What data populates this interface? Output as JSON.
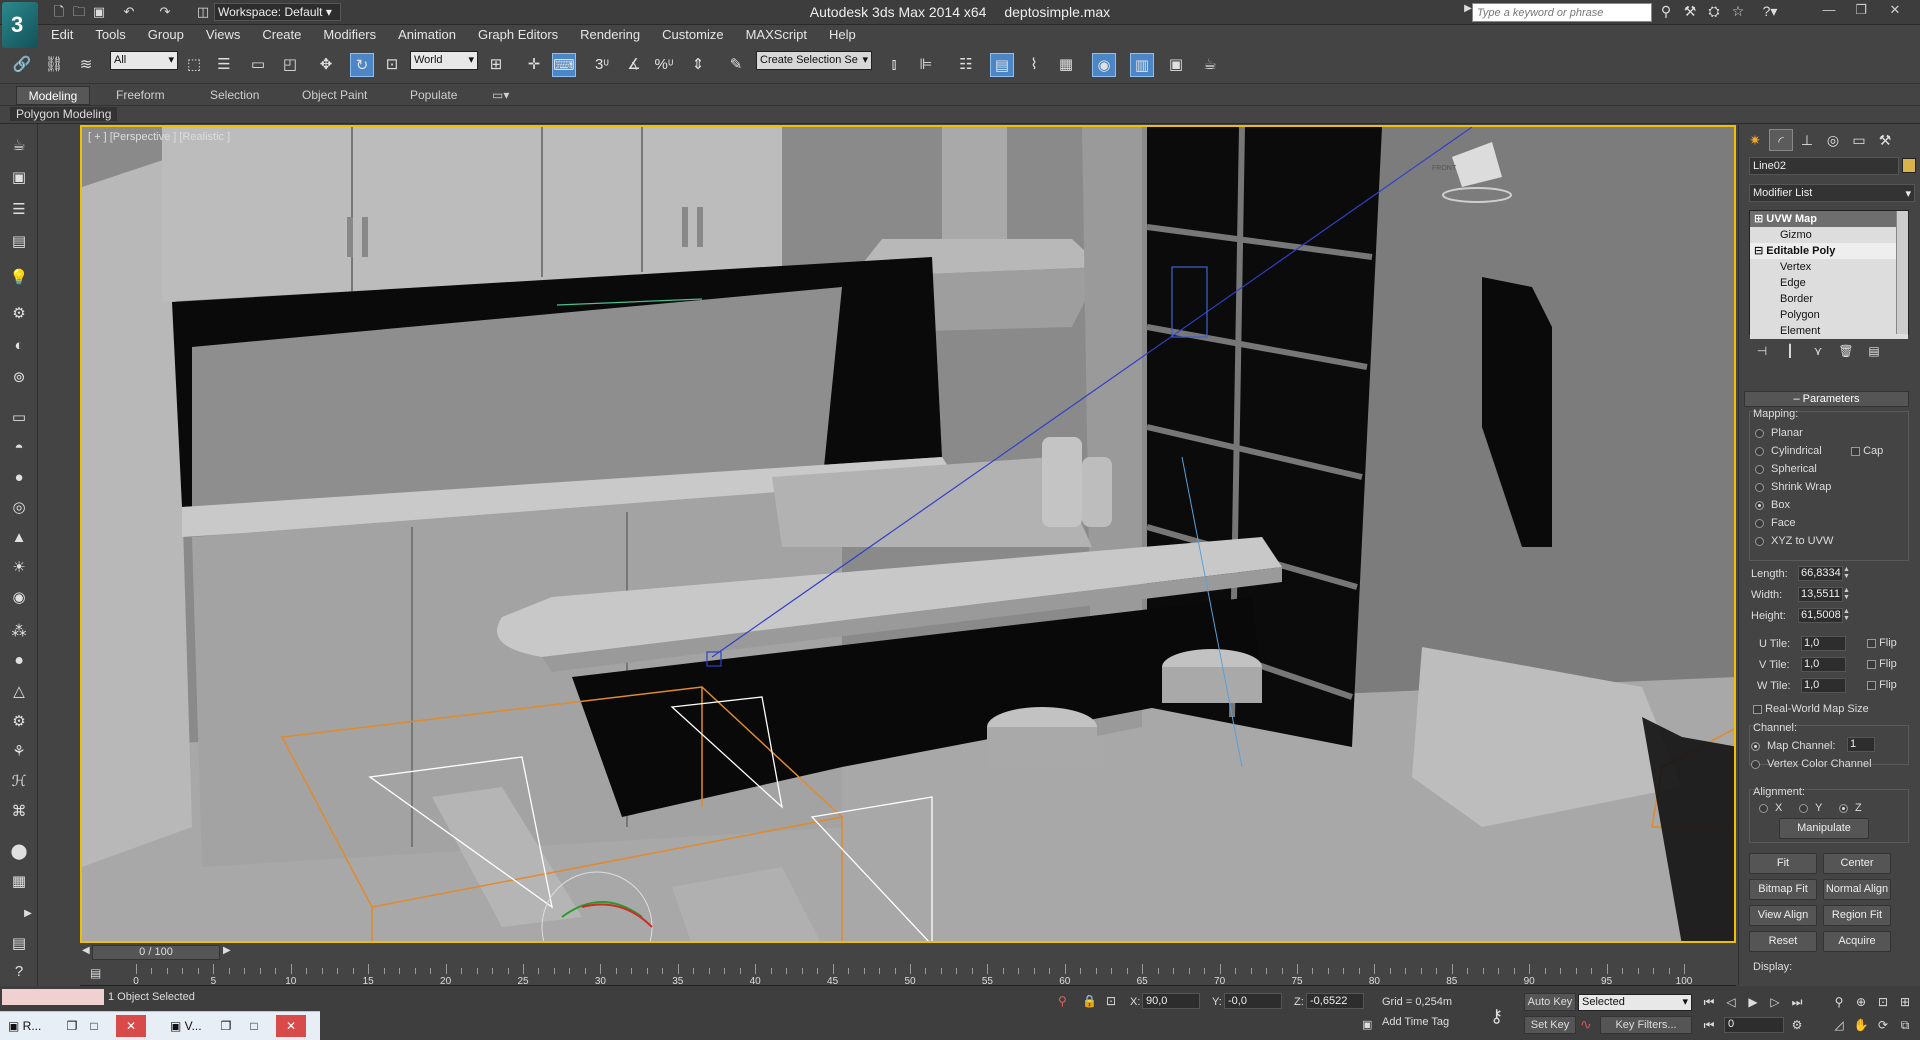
{
  "title": {
    "app": "Autodesk 3ds Max  2014 x64",
    "file": "deptosimple.max",
    "workspace": "Workspace: Default",
    "search_placeholder": "Type a keyword or phrase"
  },
  "menu": [
    "Edit",
    "Tools",
    "Group",
    "Views",
    "Create",
    "Modifiers",
    "Animation",
    "Graph Editors",
    "Rendering",
    "Customize",
    "MAXScript",
    "Help"
  ],
  "toolbar": {
    "selection_filter": "All",
    "ref_coord": "World",
    "named_selection": "Create Selection Se",
    "snap_labels": [
      "3",
      "%"
    ]
  },
  "ribbon": {
    "tabs": [
      "Modeling",
      "Freeform",
      "Selection",
      "Object Paint",
      "Populate"
    ],
    "active_tab": "Modeling",
    "panel_label": "Polygon Modeling"
  },
  "viewport": {
    "label": "[ + ] [Perspective ] [Realistic ]",
    "viewcube_label": "FRONT"
  },
  "command_panel": {
    "object_name": "Line02",
    "object_color": "#d7b44c",
    "modifier_list_label": "Modifier List",
    "stack": [
      {
        "label": "UVW Map",
        "selected": true,
        "sub": false
      },
      {
        "label": "Gizmo",
        "selected": false,
        "sub": true
      },
      {
        "label": "Editable Poly",
        "selected": false,
        "sub": false
      },
      {
        "label": "Vertex",
        "selected": false,
        "sub": true
      },
      {
        "label": "Edge",
        "selected": false,
        "sub": true
      },
      {
        "label": "Border",
        "selected": false,
        "sub": true
      },
      {
        "label": "Polygon",
        "selected": false,
        "sub": true
      },
      {
        "label": "Element",
        "selected": false,
        "sub": true
      }
    ],
    "rollout": "Parameters",
    "mapping_label": "Mapping:",
    "mapping_options": [
      "Planar",
      "Cylindrical",
      "Spherical",
      "Shrink Wrap",
      "Box",
      "Face",
      "XYZ to UVW"
    ],
    "mapping_selected": "Box",
    "cap_label": "Cap",
    "length_label": "Length:",
    "length": "66,8334",
    "width_label": "Width:",
    "width": "13,5511",
    "height_label": "Height:",
    "height": "61,5008",
    "utile_label": "U Tile:",
    "utile": "1,0",
    "vtile_label": "V Tile:",
    "vtile": "1,0",
    "wtile_label": "W Tile:",
    "wtile": "1,0",
    "flip_label": "Flip",
    "real_world_label": "Real-World Map Size",
    "channel_label": "Channel:",
    "map_channel_label": "Map Channel:",
    "map_channel": "1",
    "vertex_color_label": "Vertex Color Channel",
    "alignment_label": "Alignment:",
    "align_axes": [
      "X",
      "Y",
      "Z"
    ],
    "align_selected": "Z",
    "buttons": [
      "Manipulate",
      "Fit",
      "Center",
      "Bitmap Fit",
      "Normal Align",
      "View Align",
      "Region Fit",
      "Reset",
      "Acquire"
    ],
    "display_label": "Display:"
  },
  "timeline": {
    "slider_label": "0 / 100",
    "ticks": [
      "0",
      "5",
      "10",
      "15",
      "20",
      "25",
      "30",
      "35",
      "40",
      "45",
      "50",
      "55",
      "60",
      "65",
      "70",
      "75",
      "80",
      "85",
      "90",
      "95",
      "100"
    ]
  },
  "status": {
    "message": "1 Object Selected",
    "x_label": "X:",
    "x": "90,0",
    "y_label": "Y:",
    "y": "-0,0",
    "z_label": "Z:",
    "z": "-0,6522",
    "grid": "Grid = 0,254m",
    "auto_key": "Auto Key",
    "set_key": "Set Key",
    "key_mode": "Selected",
    "key_filters": "Key Filters...",
    "add_time_tag": "Add Time Tag",
    "frame": "0"
  },
  "taskbar": {
    "items": [
      "R...",
      "V..."
    ]
  }
}
